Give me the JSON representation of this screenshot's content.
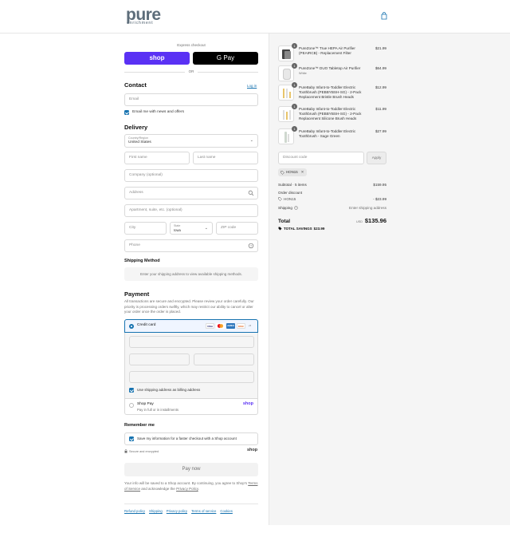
{
  "header": {
    "logo_main": "pure",
    "logo_sub": "enrichment"
  },
  "express": {
    "label": "Express checkout",
    "shop_label": "shop",
    "gpay_label": "G Pay",
    "or_label": "OR"
  },
  "contact": {
    "heading": "Contact",
    "login_link": "Log in",
    "email_placeholder": "Email",
    "news_checkbox_label": "Email me with news and offers"
  },
  "delivery": {
    "heading": "Delivery",
    "country_label": "Country/Region",
    "country_value": "United States",
    "first_name": "First name",
    "last_name": "Last name",
    "company": "Company (optional)",
    "address": "Address",
    "apartment": "Apartment, suite, etc. (optional)",
    "city": "City",
    "state_label": "State",
    "state_value": "Iowa",
    "zip": "ZIP code",
    "phone": "Phone"
  },
  "shipping_method": {
    "heading": "Shipping Method",
    "message": "Enter your shipping address to view available shipping methods."
  },
  "payment": {
    "heading": "Payment",
    "note": "All transactions are secure and encrypted. Please review your order carefully. Our priority is processing orders swiftly, which may restrict our ability to cancel or alter your order once the order is placed.",
    "credit_card_label": "Credit card",
    "card_logos": [
      "VISA",
      "MC",
      "AMEX",
      "DISC",
      "+5"
    ],
    "billing_checkbox_label": "Use shipping address as billing address",
    "shoppay_label": "Shop Pay",
    "shoppay_sub": "Pay in full or in installments",
    "shoppay_brand": "shop"
  },
  "remember": {
    "heading": "Remember me",
    "checkbox_label": "Save my information for a faster checkout with a Shop account",
    "secure_label": "Secure and encrypted",
    "brand": "shop"
  },
  "pay_button": "Pay now",
  "legal": {
    "text_before": "Your info will be saved to a Shop account. By continuing, you agree to Shop's ",
    "terms": "Terms of Service",
    "text_mid": " and acknowledge the ",
    "privacy": "Privacy Policy",
    "text_after": "."
  },
  "footer_links": [
    "Refund policy",
    "Shipping",
    "Privacy policy",
    "Terms of service",
    "Cookies"
  ],
  "cart": {
    "items": [
      {
        "qty": "1",
        "name": "PureZone™ True HEPA Air Purifier (PEAIRCB) - Replacement Filter",
        "variant": "",
        "price": "$21.99"
      },
      {
        "qty": "1",
        "name": "PureZone™ DUO Tabletop Air Purifier",
        "variant": "White",
        "price": "$64.99"
      },
      {
        "qty": "1",
        "name": "PureBaby Infant-to-Toddler Electric Toothbrush (PEBBYBSH-SG) - 2-Pack Replacement Bristle Brush Heads",
        "variant": "",
        "price": "$12.99"
      },
      {
        "qty": "1",
        "name": "PureBaby Infant-to-Toddler Electric Toothbrush (PEBBYBSH-SG) - 2-Pack Replacement Silicone Brush Heads",
        "variant": "",
        "price": "$11.99"
      },
      {
        "qty": "1",
        "name": "PureBaby Infant-to-Toddler Electric Toothbrush - Sage Green",
        "variant": "",
        "price": "$27.99"
      }
    ],
    "discount_placeholder": "Discount code",
    "apply_label": "Apply",
    "applied_code": "HON15",
    "subtotal_label": "Subtotal · 5 items",
    "subtotal_value": "$159.95",
    "order_discount_label": "Order discount",
    "discount_code_label": "HON15",
    "discount_value": "- $23.99",
    "shipping_label": "Shipping",
    "shipping_value": "Enter shipping address",
    "total_label": "Total",
    "currency": "USD",
    "total_value": "$135.96",
    "savings_label": "TOTAL SAVINGS",
    "savings_value": "$23.99"
  },
  "colors": {
    "accent": "#1773b0",
    "shop_purple": "#5a31f4"
  }
}
